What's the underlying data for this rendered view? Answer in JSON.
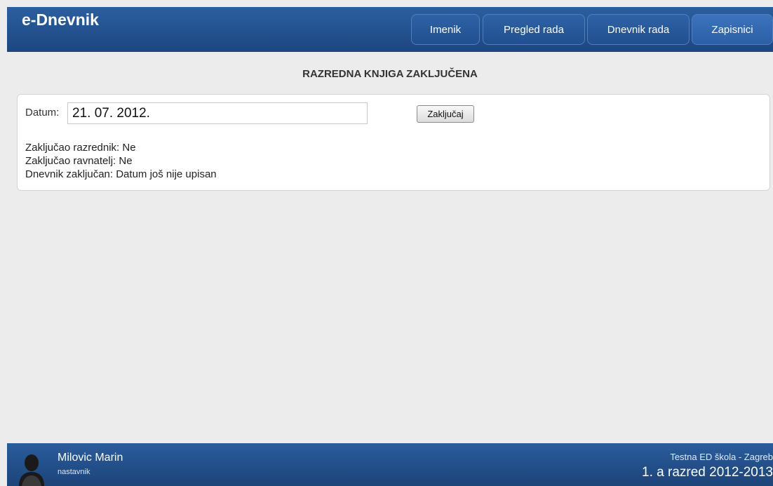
{
  "header": {
    "app_title": "e-Dnevnik",
    "nav": [
      {
        "label": "Imenik",
        "active": false
      },
      {
        "label": "Pregled rada",
        "active": false
      },
      {
        "label": "Dnevnik rada",
        "active": false
      },
      {
        "label": "Zapisnici",
        "active": true
      }
    ]
  },
  "main": {
    "heading": "RAZREDNA KNJIGA ZAKLJUČENA",
    "datum_label": "Datum:",
    "datum_value": "21. 07. 2012.",
    "lock_button": "Zaključaj",
    "status_lines": [
      "Zaključao razrednik: Ne",
      "Zaključao ravnatelj: Ne",
      "Dnevnik zaključan: Datum još nije upisan"
    ]
  },
  "footer": {
    "user_name": "Milovic Marin",
    "user_role": "nastavnik",
    "school": "Testna ED škola - Zagreb",
    "class_name": "1. a razred 2012-2013"
  },
  "colors": {
    "header_bg": "#2b5fa0",
    "footer_bg": "#1c4479",
    "page_bg": "#ececec"
  }
}
